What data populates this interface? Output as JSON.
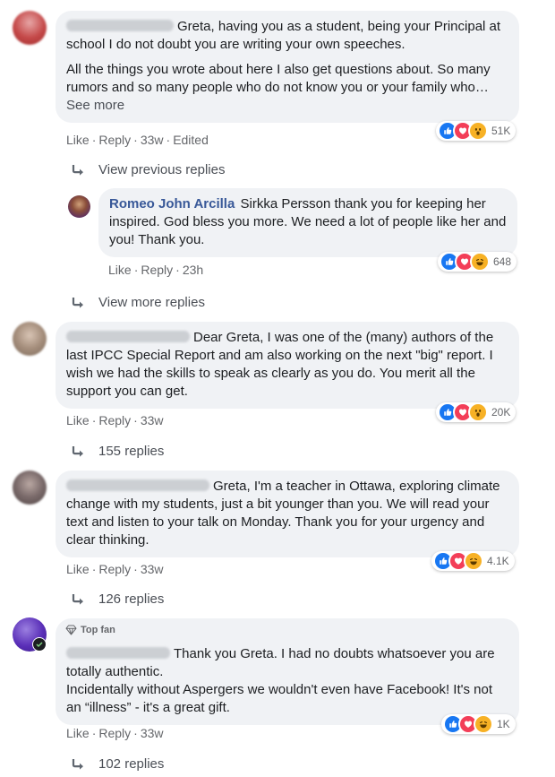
{
  "colors": {
    "bubble": "#f0f2f5",
    "link": "#385898",
    "meta": "#65676b",
    "like": "#1877f2",
    "love": "#f33e58",
    "wow": "#f7b125"
  },
  "comments": [
    {
      "text_1": "Greta, having you as a student, being your Principal at school I do not doubt you are writing your own speeches.",
      "text_2": "All the things you wrote about here I also get questions about. So many rumors and so many people who do not know you or your family who…",
      "see_more": "See more",
      "actions": {
        "like": "Like",
        "reply": "Reply",
        "time": "33w",
        "edited": "Edited"
      },
      "reactions": {
        "icons": [
          "like-icon",
          "love-icon",
          "wow-icon"
        ],
        "count": "51K"
      }
    },
    {
      "view_previous": "View previous replies"
    },
    {
      "author": "Romeo John Arcilla",
      "text": "Sirkka Persson thank you for keeping her inspired. God bless you more. We need a lot of people like her and you! Thank you.",
      "actions": {
        "like": "Like",
        "reply": "Reply",
        "time": "23h"
      },
      "reactions": {
        "icons": [
          "like-icon",
          "love-icon",
          "haha-icon"
        ],
        "count": "648"
      }
    },
    {
      "view_more": "View more replies"
    },
    {
      "text": "Dear Greta, I was one of the (many) authors of the last IPCC Special Report and am also working on the next \"big\" report. I wish we had the skills to speak as clearly as you do. You merit all the support you can get.",
      "actions": {
        "like": "Like",
        "reply": "Reply",
        "time": "33w"
      },
      "reactions": {
        "icons": [
          "like-icon",
          "love-icon",
          "wow-icon"
        ],
        "count": "20K"
      },
      "replies": "155 replies"
    },
    {
      "text": "Greta, I'm a teacher in Ottawa, exploring climate change with my students, just a bit younger than you. We will read your text and listen to your talk on Monday. Thank you for your urgency and clear thinking.",
      "actions": {
        "like": "Like",
        "reply": "Reply",
        "time": "33w"
      },
      "reactions": {
        "icons": [
          "like-icon",
          "love-icon",
          "haha-icon"
        ],
        "count": "4.1K"
      },
      "replies": "126 replies"
    },
    {
      "badge": "Top fan",
      "text_1": "Thank you Greta. I had no doubts whatsoever you are totally authentic.",
      "text_2": "Incidentally without Aspergers we wouldn't even have Facebook! It's not an “illness” - it's a great gift.",
      "actions": {
        "like": "Like",
        "reply": "Reply",
        "time": "33w"
      },
      "reactions": {
        "icons": [
          "like-icon",
          "love-icon",
          "haha-icon"
        ],
        "count": "1K"
      },
      "replies": "102 replies"
    }
  ]
}
